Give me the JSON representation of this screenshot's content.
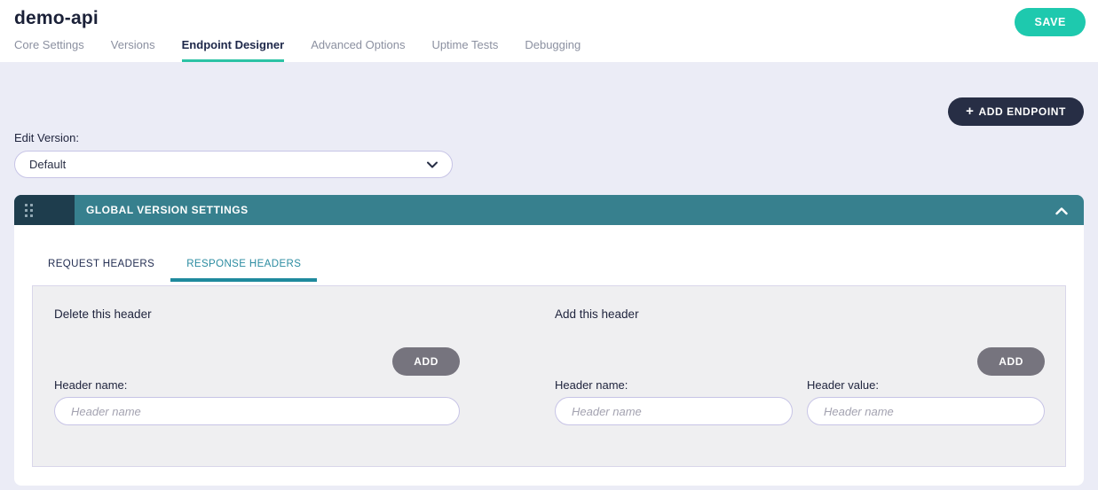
{
  "header": {
    "title": "demo-api",
    "save_label": "SAVE",
    "tabs": [
      {
        "label": "Core Settings",
        "active": false
      },
      {
        "label": "Versions",
        "active": false
      },
      {
        "label": "Endpoint Designer",
        "active": true
      },
      {
        "label": "Advanced Options",
        "active": false
      },
      {
        "label": "Uptime Tests",
        "active": false
      },
      {
        "label": "Debugging",
        "active": false
      }
    ]
  },
  "toolbar": {
    "plus": "+",
    "add_endpoint_label": "ADD ENDPOINT"
  },
  "edit_version": {
    "label": "Edit Version:",
    "selected": "Default"
  },
  "panel": {
    "title": "GLOBAL VERSION SETTINGS",
    "tabs": [
      {
        "label": "REQUEST HEADERS",
        "active": false
      },
      {
        "label": "RESPONSE HEADERS",
        "active": true
      }
    ],
    "delete_section": {
      "title": "Delete this header",
      "add_label": "ADD",
      "field": {
        "label": "Header name:",
        "placeholder": "Header name",
        "value": ""
      }
    },
    "add_section": {
      "title": "Add this header",
      "add_label": "ADD",
      "fields": [
        {
          "label": "Header name:",
          "placeholder": "Header name",
          "value": ""
        },
        {
          "label": "Header value:",
          "placeholder": "Header name",
          "value": ""
        }
      ]
    }
  },
  "colors": {
    "save_button": "#1ec9ae",
    "active_tab_underline": "#2cc3a5",
    "add_endpoint_button": "#272e45",
    "panel_bar": "#37808e",
    "panel_bar_handle": "#1e3d4d",
    "sub_tab_active": "#1f8a9e",
    "add_button_grey": "#76747e",
    "input_border": "#c7c4e6",
    "content_background": "#ebecf6",
    "grey_panel_background": "#efeff1"
  }
}
